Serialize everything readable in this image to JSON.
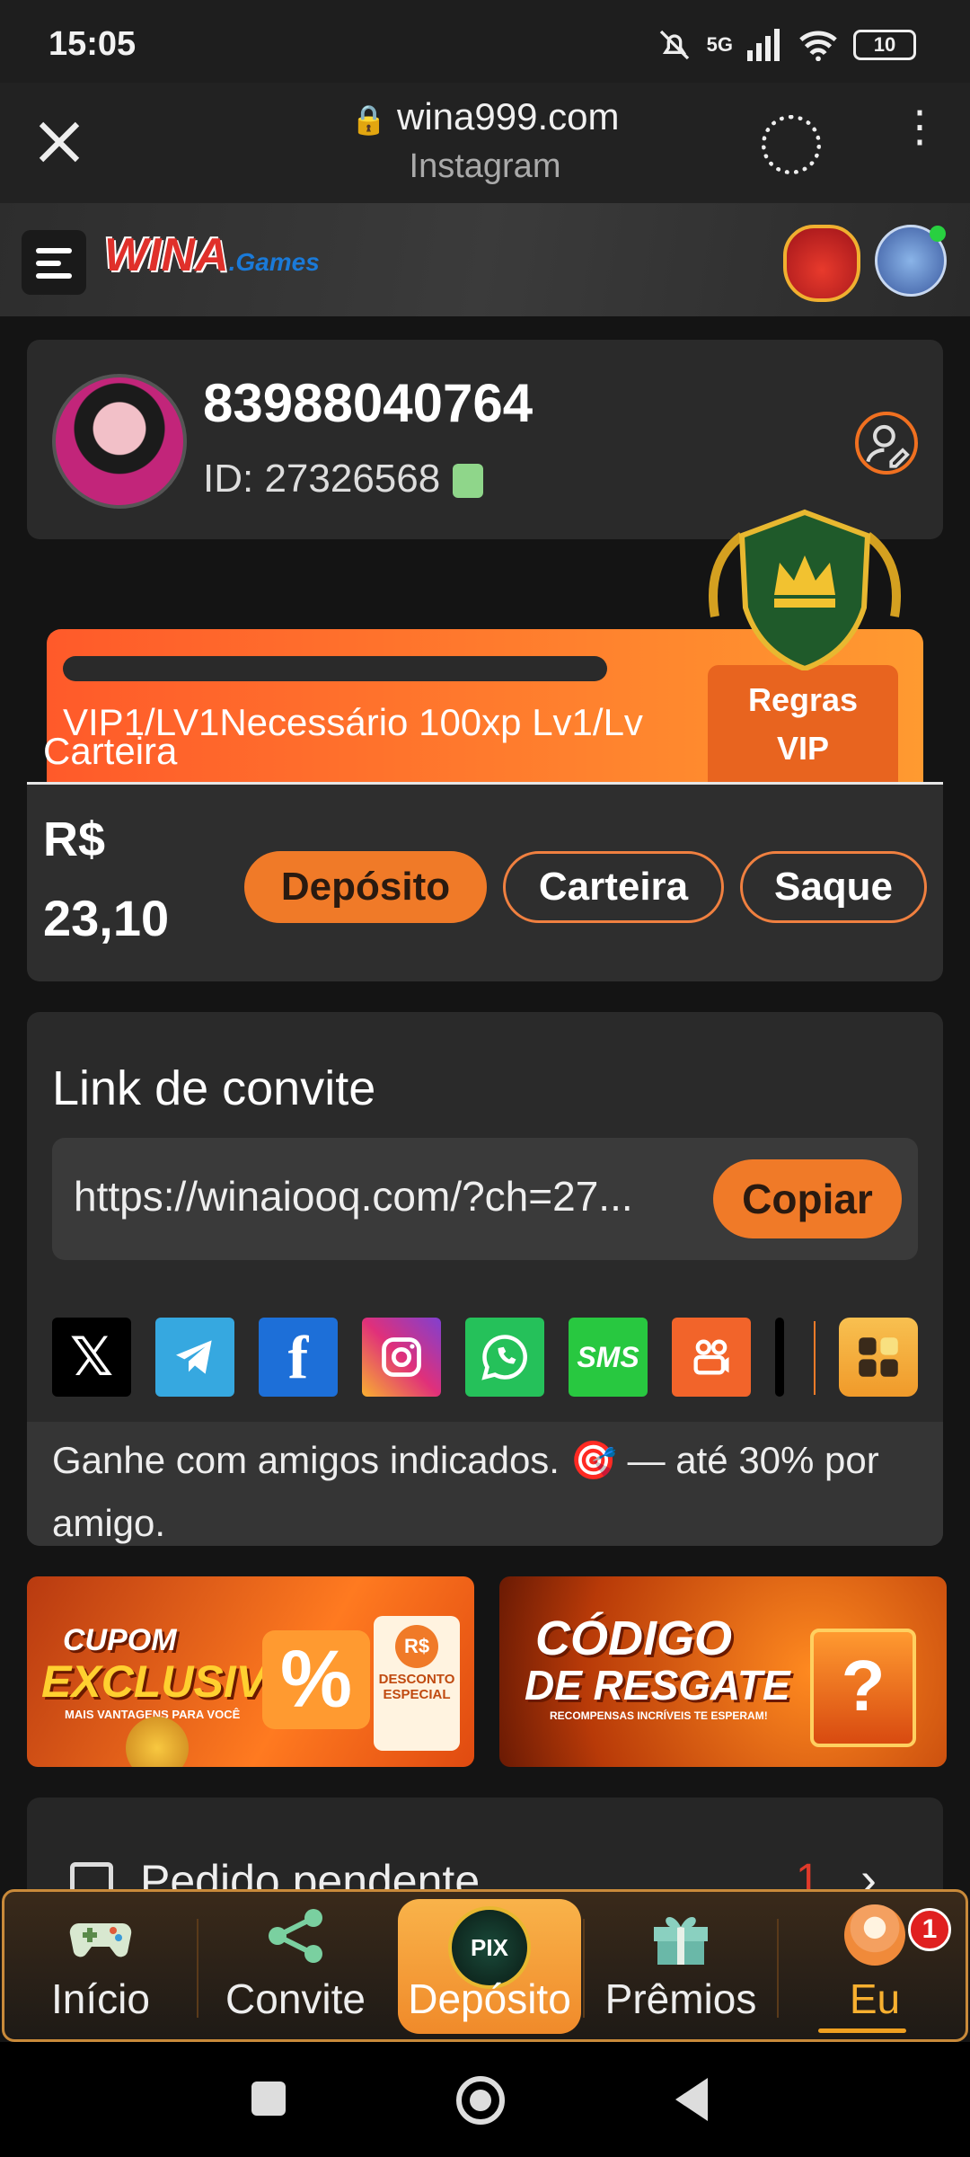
{
  "status_bar": {
    "time": "15:05",
    "network": "5G",
    "battery": "10"
  },
  "browser": {
    "url": "wina999.com",
    "subtitle": "Instagram"
  },
  "site": {
    "logo_main": "WINA",
    "logo_sub": ".Games"
  },
  "profile": {
    "username": "83988040764",
    "id_text": "ID: 27326568"
  },
  "vip": {
    "progress_fraction": 0,
    "requirement_text": "VIP1/LV1Necessário 100xp Lv1/Lv",
    "rules_line1": "Regras",
    "rules_line2": "VIP",
    "overlap_label": "Carteira"
  },
  "balance": {
    "currency": "R$",
    "amount": "23,10",
    "buttons": {
      "deposit": "Depósito",
      "wallet": "Carteira",
      "withdraw": "Saque"
    }
  },
  "invite": {
    "title": "Link de convite",
    "link": "https://winaiooq.com/?ch=27...",
    "copy_label": "Copiar",
    "share_sms": "SMS",
    "description": "Ganhe com amigos indicados. 🎯 — até 30% por amigo."
  },
  "banners": {
    "coupon_line1": "CUPOM",
    "coupon_line2": "EXCLUSIVO",
    "coupon_tag": "MAIS VANTAGENS PARA VOCÊ",
    "coupon_ticket_currency": "R$",
    "coupon_ticket_line1": "DESCONTO",
    "coupon_ticket_line2": "ESPECIAL",
    "code_line1": "CÓDIGO",
    "code_line2": "DE RESGATE",
    "code_tag": "RECOMPENSAS INCRÍVEIS TE ESPERAM!"
  },
  "pending": {
    "label": "Pedido pendente",
    "count": "1"
  },
  "bottom_nav": {
    "home": "Início",
    "invite": "Convite",
    "deposit": "Depósito",
    "deposit_icon_text": "PIX",
    "rewards": "Prêmios",
    "me": "Eu",
    "me_badge": "1"
  },
  "colors": {
    "accent": "#f07a28",
    "background": "#141414",
    "card": "#2a2a2a"
  }
}
